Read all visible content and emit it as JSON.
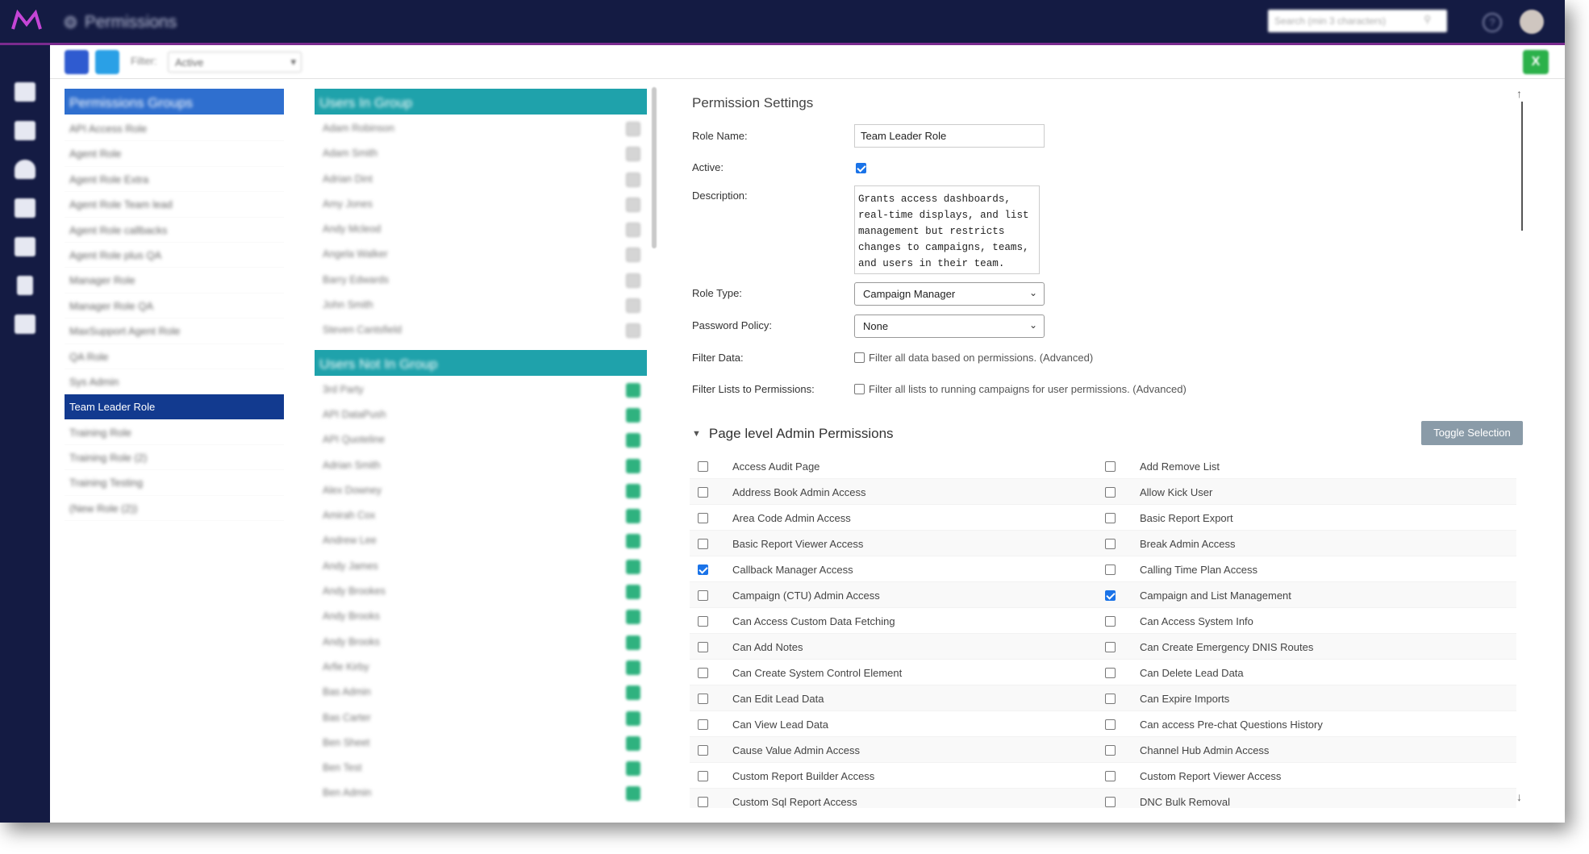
{
  "app": {
    "title": "Permissions",
    "search_placeholder": "Search (min 3 characters)",
    "help": "?"
  },
  "toolbar": {
    "filter_label": "Filter:",
    "filter_value": "Active",
    "excel_label": "X"
  },
  "groups": {
    "header": "Permissions Groups",
    "items": [
      "API Access Role",
      "Agent Role",
      "Agent Role Extra",
      "Agent Role Team lead",
      "Agent Role callbacks",
      "Agent Role plus QA",
      "Manager Role",
      "Manager Role QA",
      "MaxSupport Agent Role",
      "QA Role",
      "Sys Admin",
      "Team Leader Role",
      "Training Role",
      "Training Role (2)",
      "Training Testing",
      "(New Role (2))"
    ],
    "active_index": 11
  },
  "users_in_group": {
    "header": "Users In Group",
    "items": [
      "Adam Robinson",
      "Adam Smith",
      "Adrian Dint",
      "Amy Jones",
      "Andy Mcleod",
      "Angela Walker",
      "Barry Edwards",
      "John Smith",
      "Steven Cantsfield"
    ]
  },
  "users_not_in_group": {
    "header": "Users Not In Group",
    "items": [
      "3rd Party",
      "API DataPush",
      "API Quoteline",
      "Adrian Smith",
      "Alex Downey",
      "Amirah Cox",
      "Andrew Lee",
      "Andy James",
      "Andy Brookes",
      "Andy Brooks",
      "Andy Brooks",
      "Arfie Kirby",
      "Bas Admin",
      "Bas Carter",
      "Ben Sheet",
      "Ben Test",
      "Ben Admin"
    ]
  },
  "settings": {
    "title": "Permission Settings",
    "role_name_label": "Role Name:",
    "role_name_value": "Team Leader Role",
    "active_label": "Active:",
    "active_checked": true,
    "description_label": "Description:",
    "description_value": "Grants access dashboards,\nreal-time displays, and list\nmanagement but restricts\nchanges to campaigns, teams,\nand users in their team.",
    "role_type_label": "Role Type:",
    "role_type_value": "Campaign Manager",
    "password_policy_label": "Password Policy:",
    "password_policy_value": "None",
    "filter_data_label": "Filter Data:",
    "filter_data_text": "Filter all data based on permissions. (Advanced)",
    "filter_lists_label": "Filter Lists to Permissions:",
    "filter_lists_text": "Filter all lists to running campaigns for user permissions. (Advanced)",
    "section_title": "Page level Admin Permissions",
    "toggle_label": "Toggle Selection"
  },
  "permissions": [
    {
      "left": "Access Audit Page",
      "left_checked": false,
      "right": "Add Remove List",
      "right_checked": false
    },
    {
      "left": "Address Book Admin Access",
      "left_checked": false,
      "right": "Allow Kick User",
      "right_checked": false
    },
    {
      "left": "Area Code Admin Access",
      "left_checked": false,
      "right": "Basic Report Export",
      "right_checked": false
    },
    {
      "left": "Basic Report Viewer Access",
      "left_checked": false,
      "right": "Break Admin Access",
      "right_checked": false
    },
    {
      "left": "Callback Manager Access",
      "left_checked": true,
      "right": "Calling Time Plan Access",
      "right_checked": false
    },
    {
      "left": "Campaign (CTU) Admin Access",
      "left_checked": false,
      "right": "Campaign and List Management",
      "right_checked": true
    },
    {
      "left": "Can Access Custom Data Fetching",
      "left_checked": false,
      "right": "Can Access System Info",
      "right_checked": false
    },
    {
      "left": "Can Add Notes",
      "left_checked": false,
      "right": "Can Create Emergency DNIS Routes",
      "right_checked": false
    },
    {
      "left": "Can Create System Control Element",
      "left_checked": false,
      "right": "Can Delete Lead Data",
      "right_checked": false
    },
    {
      "left": "Can Edit Lead Data",
      "left_checked": false,
      "right": "Can Expire Imports",
      "right_checked": false
    },
    {
      "left": "Can View Lead Data",
      "left_checked": false,
      "right": "Can access Pre-chat Questions History",
      "right_checked": false
    },
    {
      "left": "Cause Value Admin Access",
      "left_checked": false,
      "right": "Channel Hub Admin Access",
      "right_checked": false
    },
    {
      "left": "Custom Report Builder Access",
      "left_checked": false,
      "right": "Custom Report Viewer Access",
      "right_checked": false
    },
    {
      "left": "Custom Sql Report Access",
      "left_checked": false,
      "right": "DNC Bulk Removal",
      "right_checked": false
    }
  ],
  "colors": {
    "topbar": "#141b43",
    "accent_purple": "#7a2b8f",
    "groups_header": "#2f6fcf",
    "users_header": "#1fa2ab",
    "active_group": "#123a8f",
    "check": "#1a73e8"
  }
}
